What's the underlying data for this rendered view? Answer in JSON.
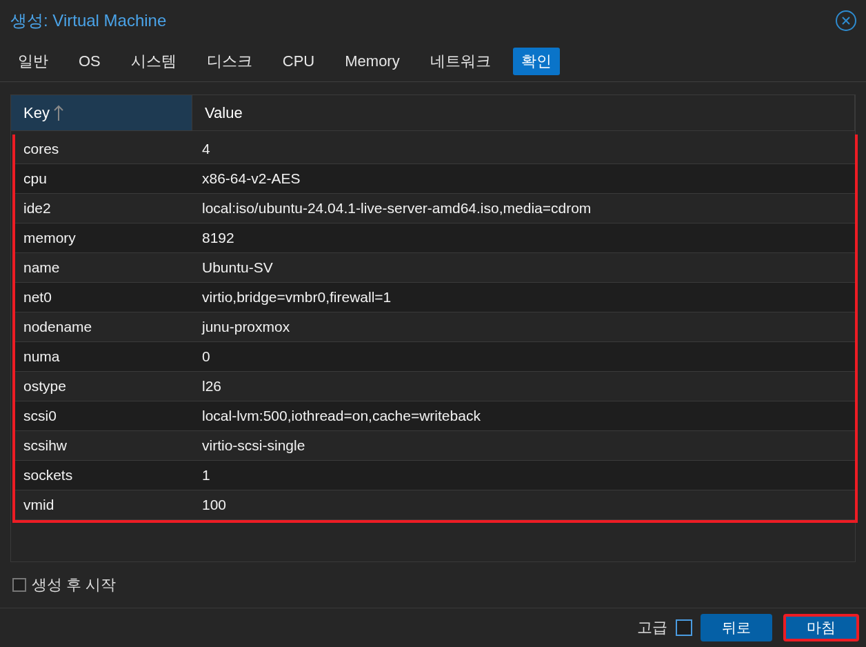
{
  "window": {
    "title": "생성: Virtual Machine"
  },
  "tabs": [
    {
      "label": "일반",
      "selected": false
    },
    {
      "label": "OS",
      "selected": false
    },
    {
      "label": "시스템",
      "selected": false
    },
    {
      "label": "디스크",
      "selected": false
    },
    {
      "label": "CPU",
      "selected": false
    },
    {
      "label": "Memory",
      "selected": false
    },
    {
      "label": "네트워크",
      "selected": false
    },
    {
      "label": "확인",
      "selected": true
    }
  ],
  "table": {
    "columns": [
      {
        "label": "Key",
        "sorted": true
      },
      {
        "label": "Value",
        "sorted": false
      }
    ],
    "rows": [
      [
        "cores",
        "4"
      ],
      [
        "cpu",
        "x86-64-v2-AES"
      ],
      [
        "ide2",
        "local:iso/ubuntu-24.04.1-live-server-amd64.iso,media=cdrom"
      ],
      [
        "memory",
        "8192"
      ],
      [
        "name",
        "Ubuntu-SV"
      ],
      [
        "net0",
        "virtio,bridge=vmbr0,firewall=1"
      ],
      [
        "nodename",
        "junu-proxmox"
      ],
      [
        "numa",
        "0"
      ],
      [
        "ostype",
        "l26"
      ],
      [
        "scsi0",
        "local-lvm:500,iothread=on,cache=writeback"
      ],
      [
        "scsihw",
        "virtio-scsi-single"
      ],
      [
        "sockets",
        "1"
      ],
      [
        "vmid",
        "100"
      ]
    ],
    "highlighted": true
  },
  "start_after_create": {
    "label": "생성 후 시작",
    "checked": false
  },
  "footer": {
    "advanced": {
      "label": "고급",
      "checked": false
    },
    "buttons": [
      {
        "label": "뒤로",
        "highlighted": false
      },
      {
        "label": "마침",
        "highlighted": true
      }
    ]
  }
}
